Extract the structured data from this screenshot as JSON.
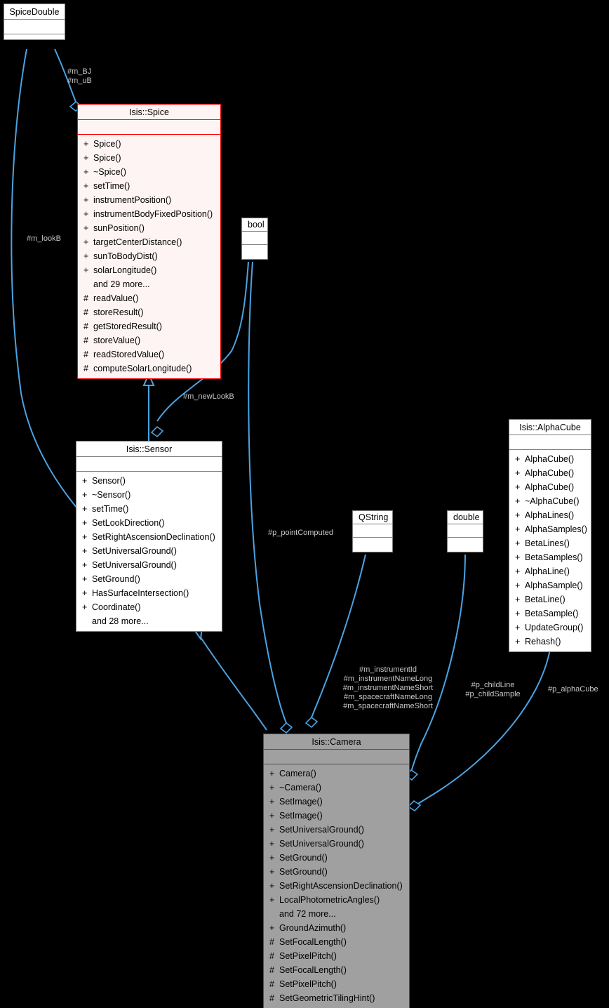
{
  "diagram": {
    "type": "uml-collaboration-diagram",
    "background": "#000000",
    "edge_color": "#4ba3e3",
    "highlight_color": "#ff0000",
    "label_color": "#c8c8c8"
  },
  "classes": {
    "spicedouble": {
      "name": "SpiceDouble",
      "style": "plain",
      "operations": []
    },
    "spice": {
      "name": "Isis::Spice",
      "style": "highlighted",
      "operations": [
        {
          "vis": "+",
          "name": "Spice()"
        },
        {
          "vis": "+",
          "name": "Spice()"
        },
        {
          "vis": "+",
          "name": "~Spice()"
        },
        {
          "vis": "+",
          "name": "setTime()"
        },
        {
          "vis": "+",
          "name": "instrumentPosition()"
        },
        {
          "vis": "+",
          "name": "instrumentBodyFixedPosition()"
        },
        {
          "vis": "+",
          "name": "sunPosition()"
        },
        {
          "vis": "+",
          "name": "targetCenterDistance()"
        },
        {
          "vis": "+",
          "name": "sunToBodyDist()"
        },
        {
          "vis": "+",
          "name": "solarLongitude()"
        },
        {
          "vis": "",
          "name": "and 29 more..."
        },
        {
          "vis": "#",
          "name": "readValue()"
        },
        {
          "vis": "#",
          "name": "storeResult()"
        },
        {
          "vis": "#",
          "name": "getStoredResult()"
        },
        {
          "vis": "#",
          "name": "storeValue()"
        },
        {
          "vis": "#",
          "name": "readStoredValue()"
        },
        {
          "vis": "#",
          "name": "computeSolarLongitude()"
        }
      ]
    },
    "sensor": {
      "name": "Isis::Sensor",
      "style": "plain",
      "operations": [
        {
          "vis": "+",
          "name": "Sensor()"
        },
        {
          "vis": "+",
          "name": "~Sensor()"
        },
        {
          "vis": "+",
          "name": "setTime()"
        },
        {
          "vis": "+",
          "name": "SetLookDirection()"
        },
        {
          "vis": "+",
          "name": "SetRightAscensionDeclination()"
        },
        {
          "vis": "+",
          "name": "SetUniversalGround()"
        },
        {
          "vis": "+",
          "name": "SetUniversalGround()"
        },
        {
          "vis": "+",
          "name": "SetGround()"
        },
        {
          "vis": "+",
          "name": "HasSurfaceIntersection()"
        },
        {
          "vis": "+",
          "name": "Coordinate()"
        },
        {
          "vis": "",
          "name": "and 28 more..."
        }
      ]
    },
    "camera": {
      "name": "Isis::Camera",
      "style": "grey",
      "operations": [
        {
          "vis": "+",
          "name": "Camera()"
        },
        {
          "vis": "+",
          "name": "~Camera()"
        },
        {
          "vis": "+",
          "name": "SetImage()"
        },
        {
          "vis": "+",
          "name": "SetImage()"
        },
        {
          "vis": "+",
          "name": "SetUniversalGround()"
        },
        {
          "vis": "+",
          "name": "SetUniversalGround()"
        },
        {
          "vis": "+",
          "name": "SetGround()"
        },
        {
          "vis": "+",
          "name": "SetGround()"
        },
        {
          "vis": "+",
          "name": "SetRightAscensionDeclination()"
        },
        {
          "vis": "+",
          "name": "LocalPhotometricAngles()"
        },
        {
          "vis": "",
          "name": "and 72 more..."
        },
        {
          "vis": "+",
          "name": "GroundAzimuth()"
        },
        {
          "vis": "#",
          "name": "SetFocalLength()"
        },
        {
          "vis": "#",
          "name": "SetPixelPitch()"
        },
        {
          "vis": "#",
          "name": "SetFocalLength()"
        },
        {
          "vis": "#",
          "name": "SetPixelPitch()"
        },
        {
          "vis": "#",
          "name": "SetGeometricTilingHint()"
        }
      ]
    },
    "alphacube": {
      "name": "Isis::AlphaCube",
      "style": "plain",
      "operations": [
        {
          "vis": "+",
          "name": "AlphaCube()"
        },
        {
          "vis": "+",
          "name": "AlphaCube()"
        },
        {
          "vis": "+",
          "name": "AlphaCube()"
        },
        {
          "vis": "+",
          "name": "~AlphaCube()"
        },
        {
          "vis": "+",
          "name": "AlphaLines()"
        },
        {
          "vis": "+",
          "name": "AlphaSamples()"
        },
        {
          "vis": "+",
          "name": "BetaLines()"
        },
        {
          "vis": "+",
          "name": "BetaSamples()"
        },
        {
          "vis": "+",
          "name": "AlphaLine()"
        },
        {
          "vis": "+",
          "name": "AlphaSample()"
        },
        {
          "vis": "+",
          "name": "BetaLine()"
        },
        {
          "vis": "+",
          "name": "BetaSample()"
        },
        {
          "vis": "+",
          "name": "UpdateGroup()"
        },
        {
          "vis": "+",
          "name": "Rehash()"
        }
      ]
    }
  },
  "types": {
    "bool": {
      "name": "bool"
    },
    "qstring": {
      "name": "QString"
    },
    "double": {
      "name": "double"
    }
  },
  "edge_labels": {
    "m_bj_ub": "#m_BJ\n#m_uB",
    "m_bj": "#m_BJ",
    "m_ub": "#m_uB",
    "m_lookb": "#m_lookB",
    "m_newlookb": "#m_newLookB",
    "p_pointcomputed": "#p_pointComputed",
    "instrument_names": "#m_instrumentId\n#m_instrumentNameLong\n#m_instrumentNameShort\n#m_spacecraftNameLong\n#m_spacecraftNameShort",
    "m_instrumentid": "#m_instrumentId",
    "m_instrumentnamelong": "#m_instrumentNameLong",
    "m_instrumentnameshort": "#m_instrumentNameShort",
    "m_spacecraftnamelong": "#m_spacecraftNameLong",
    "m_spacecraftnameshort": "#m_spacecraftNameShort",
    "p_childline": "#p_childLine",
    "p_childsample": "#p_childSample",
    "p_alphacube": "#p_alphaCube"
  }
}
